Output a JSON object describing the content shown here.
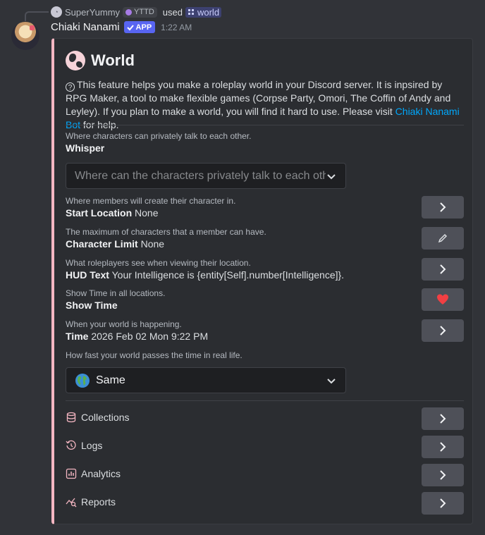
{
  "reply": {
    "username": "SuperYummy",
    "tag": "YTTD",
    "used_text": "used",
    "command": "world"
  },
  "message": {
    "author": "Chiaki Nanami",
    "app_badge": "APP",
    "timestamp": "1:22 AM"
  },
  "embed": {
    "accent_color": "#f4b6c2",
    "title": "World",
    "description_prefix": "This feature helps you make a roleplay world in your Discord server. It is inpsired by RPG Maker, a tool to make flexible games (Corpse Party, Omori, The Coffin of Andy and Leyley). If you plan to make a world, you will find it hard to use. Please visit ",
    "description_link": "Chiaki Nanami Bot",
    "description_suffix": " for help.",
    "sections": {
      "whisper": {
        "subtitle": "Where characters can privately talk to each other.",
        "label": "Whisper",
        "placeholder": "Where can the characters privately talk to each other?"
      },
      "start_location": {
        "subtitle": "Where members will create their character in.",
        "label": "Start Location",
        "value": "None"
      },
      "character_limit": {
        "subtitle": "The maximum of characters that a member can have.",
        "label": "Character Limit",
        "value": "None"
      },
      "hud_text": {
        "subtitle": "What roleplayers see when viewing their location.",
        "label": "HUD Text",
        "value": "Your Intelligence is {entity[Self].number[Intelligence]}."
      },
      "show_time": {
        "subtitle": "Show Time in all locations.",
        "label": "Show Time",
        "heart_color": "#f23f43"
      },
      "time": {
        "subtitle": "When your world is happening.",
        "label": "Time",
        "value": "2026 Feb 02 Mon 9:22 PM"
      },
      "speed": {
        "subtitle": "How fast your world passes the time in real life.",
        "selected": "Same",
        "icon": "earth-globe-icon"
      }
    },
    "menu": [
      {
        "label": "Collections",
        "icon": "database-icon"
      },
      {
        "label": "Logs",
        "icon": "history-icon"
      },
      {
        "label": "Analytics",
        "icon": "chart-icon"
      },
      {
        "label": "Reports",
        "icon": "reports-icon"
      }
    ]
  }
}
